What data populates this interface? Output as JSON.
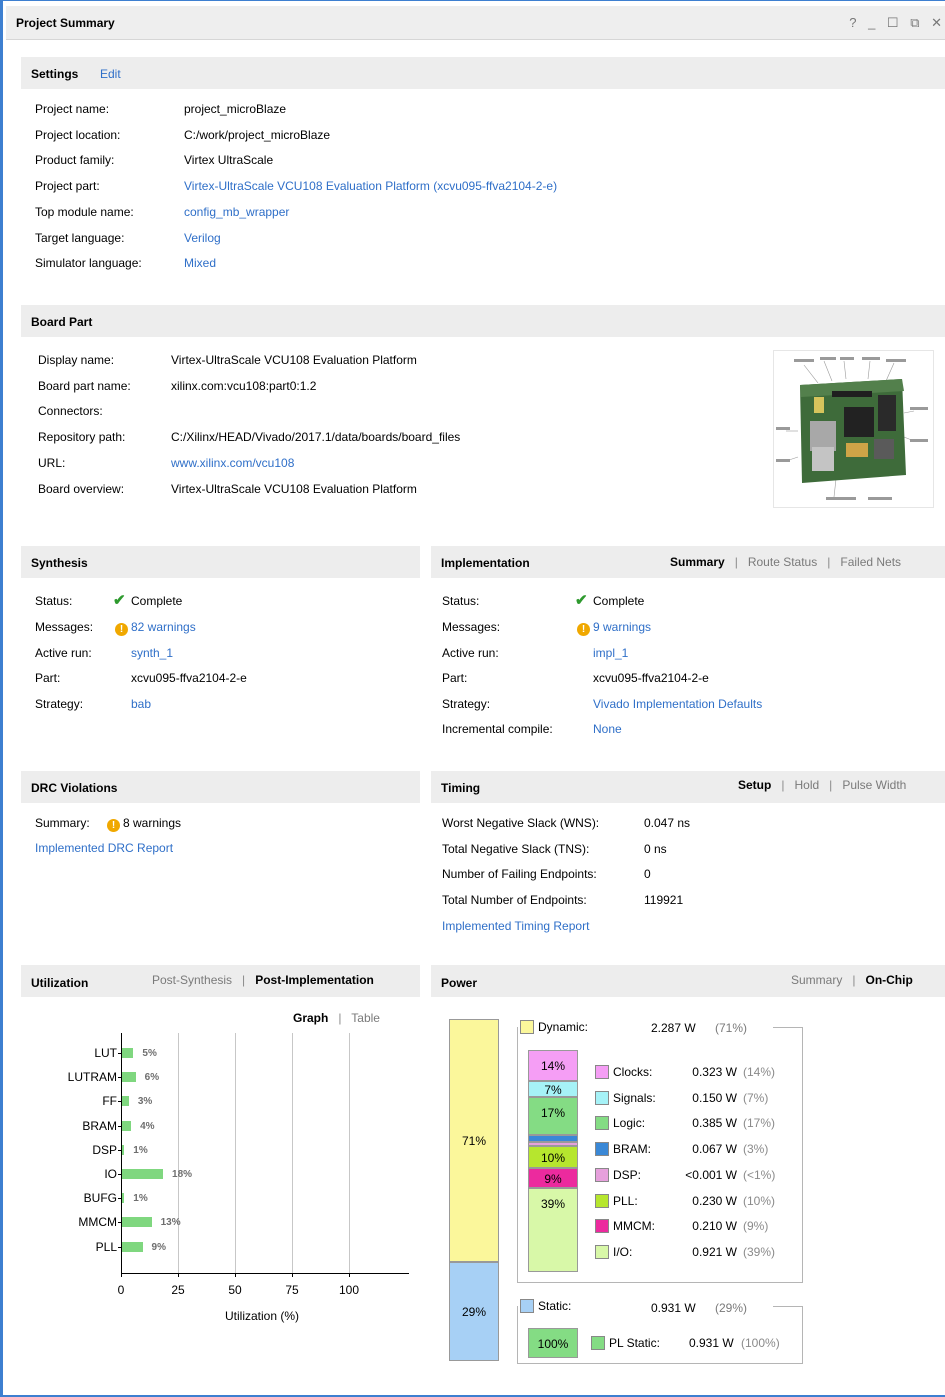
{
  "window": {
    "title": "Project Summary",
    "controls": "? _ ☐ ⧉ ✕"
  },
  "settings": {
    "title": "Settings",
    "edit": "Edit",
    "rows": [
      {
        "label": "Project name:",
        "value": "project_microBlaze"
      },
      {
        "label": "Project location:",
        "value": "C:/work/project_microBlaze"
      },
      {
        "label": "Product family:",
        "value": "Virtex UltraScale"
      },
      {
        "label": "Project part:",
        "value": "Virtex-UltraScale VCU108 Evaluation Platform (xcvu095-ffva2104-2-e)"
      },
      {
        "label": "Top module name:",
        "value": "config_mb_wrapper"
      },
      {
        "label": "Target language:",
        "value": "Verilog"
      },
      {
        "label": "Simulator language:",
        "value": "Mixed"
      }
    ]
  },
  "board": {
    "title": "Board Part",
    "rows": [
      {
        "label": "Display name:",
        "value": "Virtex-UltraScale VCU108 Evaluation Platform"
      },
      {
        "label": "Board part name:",
        "value": "xilinx.com:vcu108:part0:1.2"
      },
      {
        "label": "Connectors:",
        "value": ""
      },
      {
        "label": "Repository path:",
        "value": "C:/Xilinx/HEAD/Vivado/2017.1/data/boards/board_files"
      },
      {
        "label": "URL:",
        "value": "www.xilinx.com/vcu108"
      },
      {
        "label": "Board overview:",
        "value": "Virtex-UltraScale VCU108 Evaluation Platform"
      }
    ]
  },
  "synthesis": {
    "title": "Synthesis",
    "status_label": "Status:",
    "status": "Complete",
    "messages_label": "Messages:",
    "messages": "82 warnings",
    "run_label": "Active run:",
    "run": "synth_1",
    "part_label": "Part:",
    "part": "xcvu095-ffva2104-2-e",
    "strategy_label": "Strategy:",
    "strategy": "bab"
  },
  "implementation": {
    "title": "Implementation",
    "tabs": [
      "Summary",
      "Route Status",
      "Failed Nets"
    ],
    "status_label": "Status:",
    "status": "Complete",
    "messages_label": "Messages:",
    "messages": "9 warnings",
    "run_label": "Active run:",
    "run": "impl_1",
    "part_label": "Part:",
    "part": "xcvu095-ffva2104-2-e",
    "strategy_label": "Strategy:",
    "strategy": "Vivado Implementation Defaults",
    "incr_label": "Incremental compile:",
    "incr": "None"
  },
  "drc": {
    "title": "DRC Violations",
    "summary_label": "Summary:",
    "summary": "8 warnings",
    "report": "Implemented DRC Report"
  },
  "timing": {
    "title": "Timing",
    "tabs": [
      "Setup",
      "Hold",
      "Pulse Width"
    ],
    "rows": [
      {
        "label": "Worst Negative Slack (WNS):",
        "value": "0.047 ns"
      },
      {
        "label": "Total Negative Slack (TNS):",
        "value": "0 ns"
      },
      {
        "label": "Number of Failing Endpoints:",
        "value": "0"
      },
      {
        "label": "Total Number of Endpoints:",
        "value": "119921"
      }
    ],
    "report": "Implemented Timing Report"
  },
  "utilization": {
    "title": "Utilization",
    "tabs": [
      "Post-Synthesis",
      "Post-Implementation"
    ],
    "view_tabs": [
      "Graph",
      "Table"
    ]
  },
  "chart_data": {
    "type": "bar",
    "orientation": "horizontal",
    "categories": [
      "LUT",
      "LUTRAM",
      "FF",
      "BRAM",
      "DSP",
      "IO",
      "BUFG",
      "MMCM",
      "PLL"
    ],
    "values": [
      5,
      6,
      3,
      4,
      1,
      18,
      1,
      13,
      9
    ],
    "labels": [
      "5%",
      "6%",
      "3%",
      "4%",
      "1%",
      "18%",
      "1%",
      "13%",
      "9%"
    ],
    "xlabel": "Utilization (%)",
    "xticks": [
      "0",
      "25",
      "50",
      "75",
      "100"
    ],
    "xlim": [
      0,
      100
    ],
    "bar_color": "#7fd77f"
  },
  "power": {
    "title": "Power",
    "tabs": [
      "Summary",
      "On-Chip"
    ],
    "dynamic": {
      "label": "Dynamic:",
      "value": "2.287 W",
      "pct": "(71%)",
      "bar": "71%",
      "fraction": 71
    },
    "static": {
      "label": "Static:",
      "value": "0.931 W",
      "pct": "(29%)",
      "bar": "29%",
      "fraction": 29
    },
    "breakdown": [
      {
        "label": "Clocks:",
        "value": "0.323 W",
        "pct": "(14%)",
        "bar": "14%",
        "share": 14,
        "color": "#f59ef5"
      },
      {
        "label": "Signals:",
        "value": "0.150 W",
        "pct": "(7%)",
        "bar": "7%",
        "share": 7,
        "color": "#a6f2f7"
      },
      {
        "label": "Logic:",
        "value": "0.385 W",
        "pct": "(17%)",
        "bar": "17%",
        "share": 17,
        "color": "#84dc84"
      },
      {
        "label": "BRAM:",
        "value": "0.067 W",
        "pct": "(3%)",
        "bar": "",
        "share": 3,
        "color": "#3a88d6"
      },
      {
        "label": "DSP:",
        "value": "<0.001 W",
        "pct": "(<1%)",
        "bar": "",
        "share": 1,
        "color": "#e6a0dc"
      },
      {
        "label": "PLL:",
        "value": "0.230 W",
        "pct": "(10%)",
        "bar": "10%",
        "share": 10,
        "color": "#b6e62e"
      },
      {
        "label": "MMCM:",
        "value": "0.210 W",
        "pct": "(9%)",
        "bar": "9%",
        "share": 9,
        "color": "#ec2a9e"
      },
      {
        "label": "I/O:",
        "value": "0.921 W",
        "pct": "(39%)",
        "bar": "39%",
        "share": 39,
        "color": "#d8f8a8"
      }
    ],
    "pl_static": {
      "label": "PL Static:",
      "value": "0.931 W",
      "pct": "(100%)",
      "bar": "100%",
      "color": "#84dc84"
    },
    "colors": {
      "dynamic": "#fbf79b",
      "static": "#a7d0f5"
    }
  }
}
